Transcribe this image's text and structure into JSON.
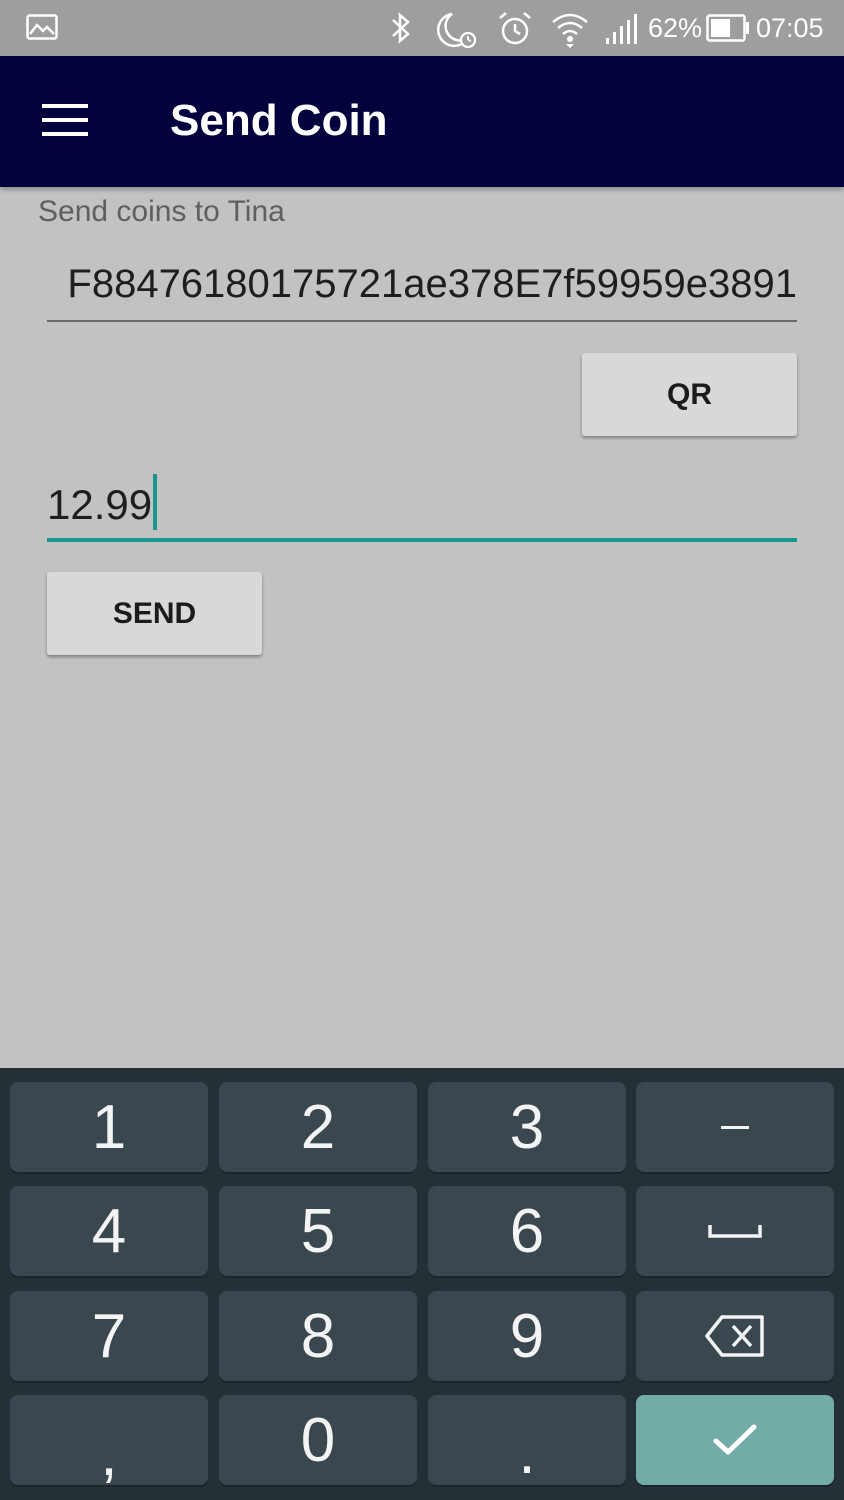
{
  "status_bar": {
    "battery_percent": "62%",
    "time": "07:05",
    "icons": [
      "gallery-icon",
      "bluetooth-icon",
      "do-not-disturb-icon",
      "alarm-icon",
      "wifi-icon",
      "signal-icon",
      "battery-icon"
    ]
  },
  "app_bar": {
    "title": "Send Coin",
    "menu_icon": "hamburger-menu-icon"
  },
  "form": {
    "subtitle": "Send coins to Tina",
    "address_value": "F88476180175721ae378E7f59959e3891",
    "qr_label": "QR",
    "amount_value": "12.99",
    "send_label": "SEND"
  },
  "keyboard": {
    "rows": [
      [
        "1",
        "2",
        "3",
        "−"
      ],
      [
        "4",
        "5",
        "6",
        "␣"
      ],
      [
        "7",
        "8",
        "9",
        "⌫"
      ],
      [
        ",",
        "0",
        ".",
        "✓"
      ]
    ],
    "icons": [
      "minus-key",
      "space-icon",
      "backspace-icon",
      "done-check-icon"
    ]
  },
  "colors": {
    "app_bar": "#03023d",
    "background": "#c2c2c2",
    "accent": "#18958c",
    "keyboard_bg": "#253036",
    "key_bg": "#3b474e",
    "done_key": "#72aca6"
  }
}
